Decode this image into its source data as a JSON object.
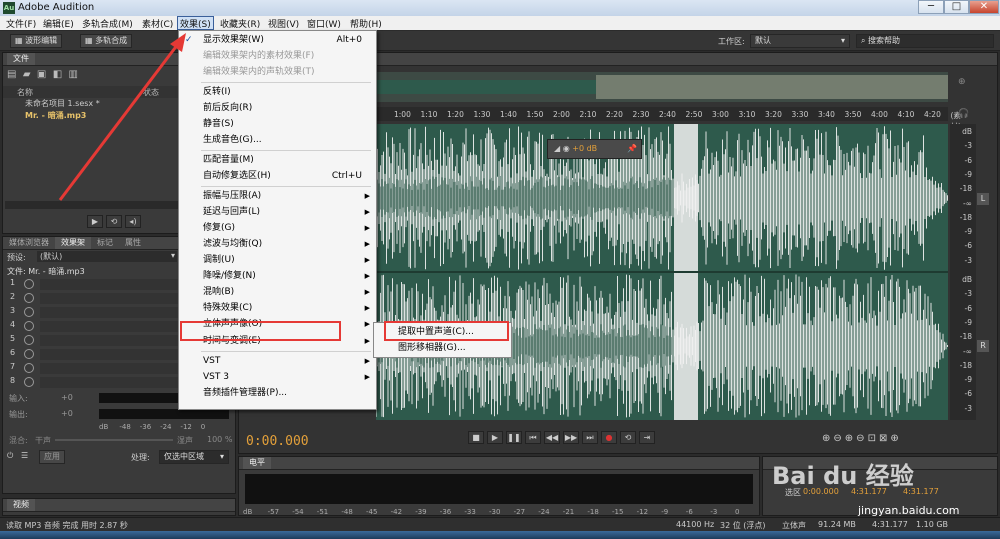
{
  "app": {
    "title": "Adobe Audition",
    "logo": "Au"
  },
  "menubar": [
    "文件(F)",
    "编辑(E)",
    "多轨合成(M)",
    "素材(C)",
    "效果(S)",
    "收藏夹(R)",
    "视图(V)",
    "窗口(W)",
    "帮助(H)"
  ],
  "toolbar": {
    "waveform_edit": "波形编辑",
    "multitrack": "多轨合成",
    "workspace_label": "工作区:",
    "workspace_value": "默认",
    "search_placeholder": "搜索帮助"
  },
  "files_panel": {
    "title": "文件",
    "col_name": "名称",
    "col_status": "状态",
    "items": [
      "未命名项目 1.sesx *",
      "Mr. - 暗涌.mp3"
    ]
  },
  "effects_panel": {
    "tabs": [
      "媒体浏览器",
      "效果架",
      "标记",
      "属性"
    ],
    "preset_label": "预设:",
    "preset_value": "(默认)",
    "file_label": "文件: Mr. - 暗涌.mp3",
    "slots": [
      "1",
      "2",
      "3",
      "4",
      "5",
      "6",
      "7",
      "8"
    ],
    "input_label": "输入:",
    "output_label": "输出:",
    "gain": "+0",
    "meter_ticks": [
      "dB",
      "-48",
      "-36",
      "-24",
      "-12",
      "0"
    ],
    "mix_label": "混合:",
    "dry": "干声",
    "wet": "湿声",
    "mix_value": "100 %",
    "apply": "应用",
    "process_label": "处理:",
    "process_value": "仅选中区域"
  },
  "video_panel": {
    "title": "视频"
  },
  "ruler_ticks": [
    "1:00",
    "1:10",
    "1:20",
    "1:30",
    "1:40",
    "1:50",
    "2:00",
    "2:10",
    "2:20",
    "2:30",
    "2:40",
    "2:50",
    "3:00",
    "3:10",
    "3:20",
    "3:30",
    "3:40",
    "3:50",
    "4:00",
    "4:10",
    "4:20",
    "(素材)"
  ],
  "db_scale": [
    "dB",
    "-3",
    "-6",
    "-9",
    "-18",
    "-∞",
    "-18",
    "-9",
    "-6",
    "-3",
    "dB",
    "-3",
    "-6",
    "-9",
    "-18",
    "-∞",
    "-18",
    "-9",
    "-6",
    "-3"
  ],
  "channel_labels": {
    "left": "L",
    "right": "R"
  },
  "hud": {
    "gain": "+0 dB"
  },
  "time_display": "0:00.000",
  "level_panel": {
    "title": "电平",
    "ticks": [
      "dB",
      "-57",
      "-54",
      "-51",
      "-48",
      "-45",
      "-42",
      "-39",
      "-36",
      "-33",
      "-30",
      "-27",
      "-24",
      "-21",
      "-18",
      "-15",
      "-12",
      "-9",
      "-6",
      "-3",
      "0"
    ]
  },
  "selection": {
    "label": "选区",
    "start": "0:00.000",
    "end": "4:31.177",
    "duration": "4:31.177"
  },
  "effects_menu": [
    {
      "label": "显示效果架(W)",
      "shortcut": "Alt+0",
      "checked": true
    },
    {
      "label": "编辑效果架内的素材效果(F)",
      "disabled": true
    },
    {
      "label": "编辑效果架内的声轨效果(T)",
      "disabled": true
    },
    {
      "label": "反转(I)"
    },
    {
      "label": "前后反向(R)"
    },
    {
      "label": "静音(S)"
    },
    {
      "label": "生成音色(G)..."
    },
    {
      "label": "匹配音量(M)"
    },
    {
      "label": "自动修复选区(H)",
      "shortcut": "Ctrl+U"
    },
    {
      "label": "振幅与压限(A)"
    },
    {
      "label": "延迟与回声(L)"
    },
    {
      "label": "修复(G)"
    },
    {
      "label": "滤波与均衡(Q)"
    },
    {
      "label": "调制(U)"
    },
    {
      "label": "降噪/修复(N)"
    },
    {
      "label": "混响(B)"
    },
    {
      "label": "特殊效果(C)"
    },
    {
      "label": "立体声声像(O)"
    },
    {
      "label": "时间与变调(E)"
    },
    {
      "label": "VST"
    },
    {
      "label": "VST 3"
    },
    {
      "label": "音频插件管理器(P)..."
    }
  ],
  "submenu": [
    "提取中置声道(C)...",
    "图形移相器(G)..."
  ],
  "status": {
    "left": "读取 MP3 音频 完成 用时 2.87 秒",
    "rate": "44100 Hz",
    "bits": "32 位 (浮点)",
    "channels": "立体声",
    "size": "91.24 MB",
    "duration": "4:31.177",
    "free": "1.10 GB"
  },
  "watermark": {
    "brand": "Bai du 经验",
    "url": "jingyan.baidu.com"
  },
  "colors": {
    "wave_bg": "#2e5a4c",
    "wave_fg": "#f2f2f2",
    "accent_time": "#e3a03a",
    "annotation": "#e53935"
  }
}
